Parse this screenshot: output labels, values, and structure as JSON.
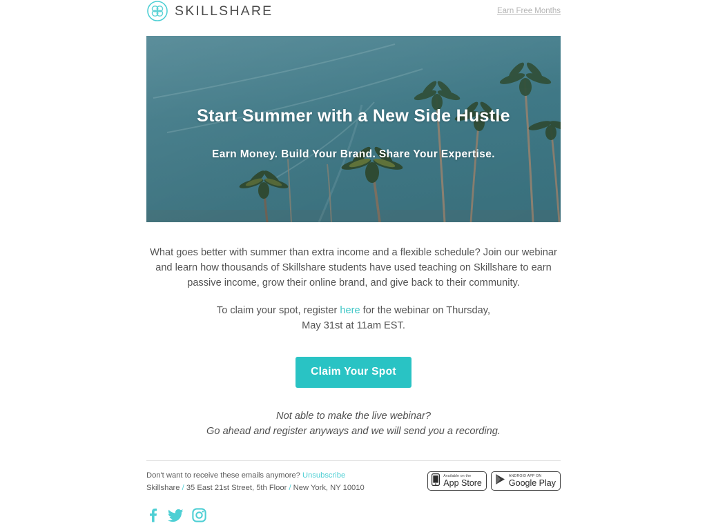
{
  "header": {
    "brand_name": "SKILLSHARE",
    "logo_icon": "skillshare-logo-icon",
    "earn_free_months": "Earn Free Months"
  },
  "hero": {
    "headline": "Start Summer with a New Side Hustle",
    "subheadline": "Earn Money. Build Your Brand. Share Your Expertise.",
    "image_description": "palm trees against teal sky"
  },
  "body": {
    "paragraph1": "What goes better with summer than extra income and a flexible schedule? Join our webinar and learn how thousands of Skillshare students have used teaching on Skillshare to earn passive income, grow their online brand, and give back to their community.",
    "para2_before": "To claim your spot, register ",
    "para2_link": "here",
    "para2_after": " for the webinar on Thursday,",
    "para2_line2": "May 31st at 11am EST."
  },
  "cta": {
    "label": "Claim Your Spot"
  },
  "note": {
    "line1": "Not able to make the live webinar?",
    "line2": "Go ahead and register anyways and we will send you a recording."
  },
  "footer": {
    "unsub_prefix": "Don't want to receive these emails anymore? ",
    "unsub_label": "Unsubscribe",
    "company": "Skillshare",
    "sep": "/",
    "address": "35 East 21st Street, 5th Floor",
    "city": "New York, NY 10010",
    "badges": [
      {
        "sub": "Available on the",
        "main": "App Store",
        "icon": "apple-iphone-icon"
      },
      {
        "sub": "ANDROID APP ON",
        "main": "Google Play",
        "icon": "google-play-triangle-icon"
      }
    ],
    "socials": [
      {
        "name": "facebook-icon"
      },
      {
        "name": "twitter-icon"
      },
      {
        "name": "instagram-icon"
      }
    ]
  },
  "colors": {
    "teal": "#29c3c4",
    "link_teal": "#3ec6c6",
    "sky": "#3f7885",
    "text": "#545454",
    "muted": "#b4b4b4"
  }
}
